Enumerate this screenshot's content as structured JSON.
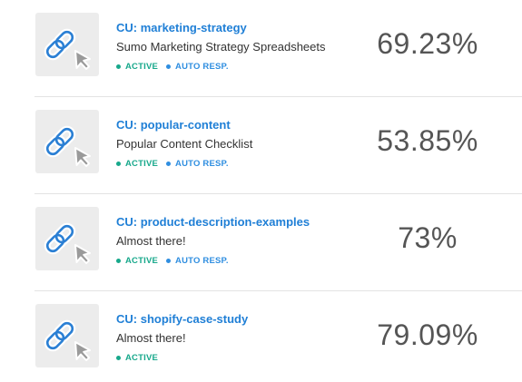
{
  "items": [
    {
      "title": "CU: marketing-strategy",
      "subtitle": "Sumo Marketing Strategy Spreadsheets",
      "badges": {
        "active": "ACTIVE",
        "auto": "AUTO RESP."
      },
      "percent": "69.23%"
    },
    {
      "title": "CU: popular-content",
      "subtitle": "Popular Content Checklist",
      "badges": {
        "active": "ACTIVE",
        "auto": "AUTO RESP."
      },
      "percent": "53.85%"
    },
    {
      "title": "CU: product-description-examples",
      "subtitle": "Almost there!",
      "badges": {
        "active": "ACTIVE",
        "auto": "AUTO RESP."
      },
      "percent": "73%"
    },
    {
      "title": "CU: shopify-case-study",
      "subtitle": "Almost there!",
      "badges": {
        "active": "ACTIVE"
      },
      "percent": "79.09%"
    }
  ],
  "colors": {
    "title": "#1f7fd6",
    "active": "#17a88b",
    "auto_resp": "#2f8ee0",
    "thumb_bg": "#ececec",
    "percent": "#555555"
  },
  "icons": [
    "link-cursor-icon"
  ]
}
